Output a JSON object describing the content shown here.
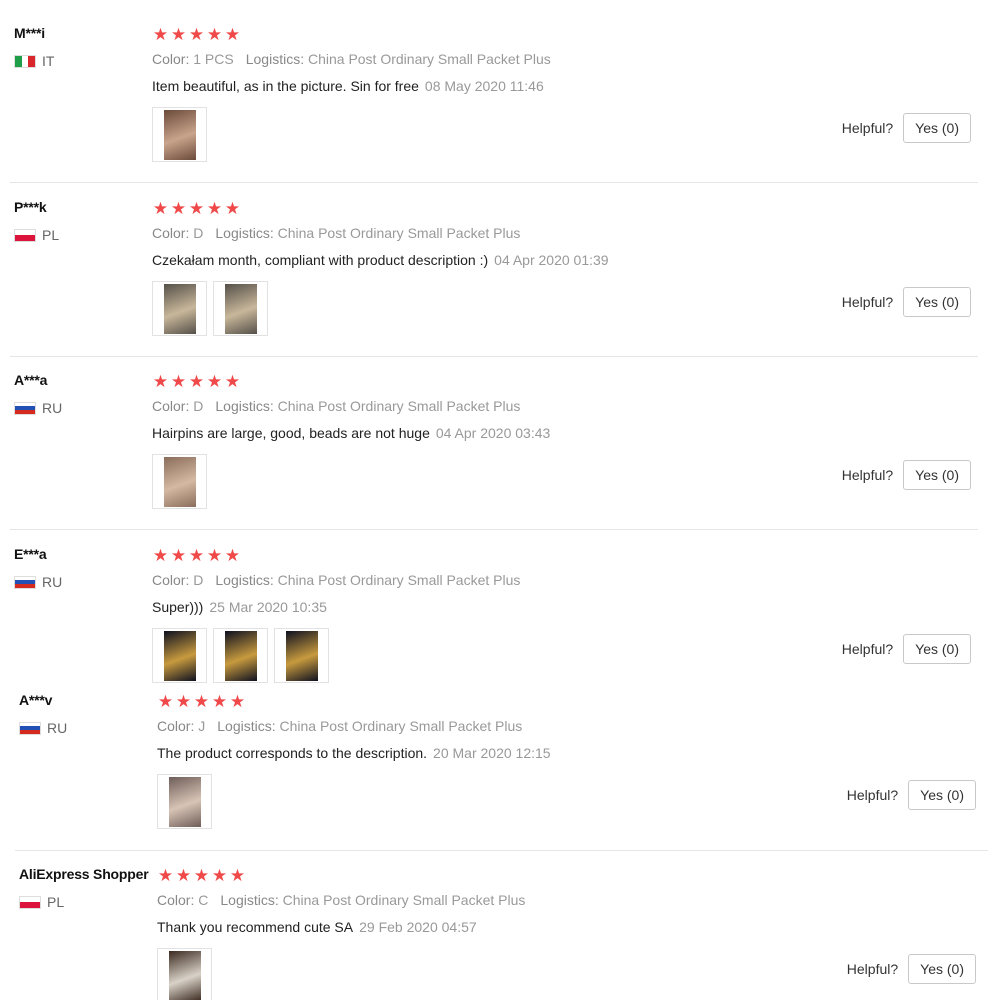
{
  "labels": {
    "color": "Color:",
    "logistics": "Logistics:",
    "helpful": "Helpful?"
  },
  "reviews": [
    {
      "user": "M***i",
      "country": "IT",
      "flag_colors": [
        "#1f9e4a",
        "#ffffff",
        "#d8262c"
      ],
      "stars": 5,
      "color": "1 PCS",
      "logistics": "China Post Ordinary Small Packet Plus",
      "text": "Item beautiful, as in the picture. Sin for free",
      "date": "08 May 2020 11:46",
      "photos": 1,
      "helpful_btn": "Yes (0)"
    },
    {
      "user": "P***k",
      "country": "PL",
      "flag_colors": [
        "#ffffff",
        "#dc143c"
      ],
      "stars": 5,
      "color": "D",
      "logistics": "China Post Ordinary Small Packet Plus",
      "text": "Czekałam month, compliant with product description :)",
      "date": "04 Apr 2020 01:39",
      "photos": 2,
      "helpful_btn": "Yes (0)"
    },
    {
      "user": "A***a",
      "country": "RU",
      "flag_colors": [
        "#ffffff",
        "#2350b4",
        "#d52b1e"
      ],
      "stars": 5,
      "color": "D",
      "logistics": "China Post Ordinary Small Packet Plus",
      "text": "Hairpins are large, good, beads are not huge",
      "date": "04 Apr 2020 03:43",
      "photos": 1,
      "helpful_btn": "Yes (0)"
    },
    {
      "user": "E***a",
      "country": "RU",
      "flag_colors": [
        "#ffffff",
        "#2350b4",
        "#d52b1e"
      ],
      "stars": 5,
      "color": "D",
      "logistics": "China Post Ordinary Small Packet Plus",
      "text": "Super)))",
      "date": "25 Mar 2020 10:35",
      "photos": 3,
      "helpful_btn": "Yes (0)"
    },
    {
      "user": "A***v",
      "country": "RU",
      "flag_colors": [
        "#ffffff",
        "#2350b4",
        "#d52b1e"
      ],
      "stars": 5,
      "color": "J",
      "logistics": "China Post Ordinary Small Packet Plus",
      "text": "The product corresponds to the description.",
      "date": "20 Mar 2020 12:15",
      "photos": 1,
      "helpful_btn": "Yes (0)"
    },
    {
      "user": "AliExpress Shopper",
      "country": "PL",
      "flag_colors": [
        "#ffffff",
        "#dc143c"
      ],
      "stars": 5,
      "color": "C",
      "logistics": "China Post Ordinary Small Packet Plus",
      "text": "Thank you recommend cute SA",
      "date": "29 Feb 2020 04:57",
      "photos": 1,
      "helpful_btn": "Yes (0)"
    }
  ]
}
